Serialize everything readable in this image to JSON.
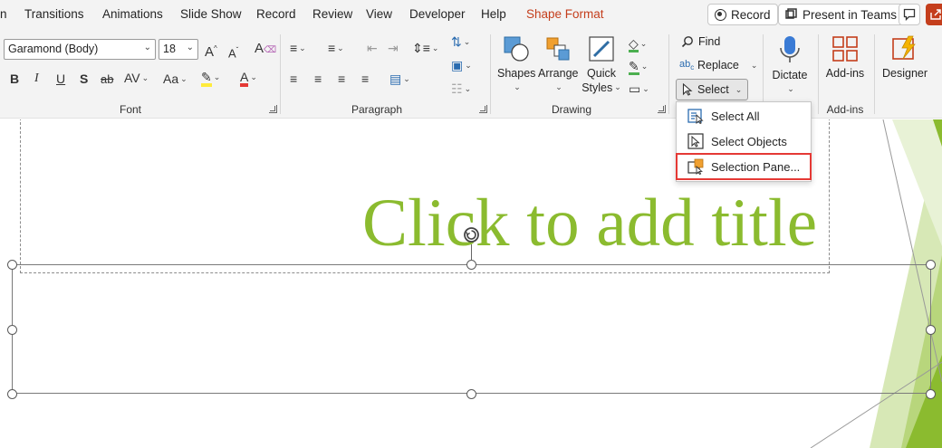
{
  "tabs": [
    "n",
    "Transitions",
    "Animations",
    "Slide Show",
    "Record",
    "Review",
    "View",
    "Developer",
    "Help",
    "Shape Format"
  ],
  "top_buttons": {
    "record": "Record",
    "present": "Present in Teams"
  },
  "font": {
    "name": "Garamond (Body)",
    "size": "18"
  },
  "groups": {
    "font": "Font",
    "paragraph": "Paragraph",
    "drawing": "Drawing",
    "add_ins": "Add-ins"
  },
  "drawing_buttons": {
    "shapes": "Shapes",
    "arrange": "Arrange",
    "quick_styles_1": "Quick",
    "quick_styles_2": "Styles"
  },
  "editing": {
    "find": "Find",
    "replace": "Replace",
    "select": "Select"
  },
  "voice": {
    "dictate": "Dictate"
  },
  "addins": {
    "addins": "Add-ins",
    "designer": "Designer"
  },
  "menu": {
    "items": [
      {
        "label": "Select All",
        "icon": "select-all-icon"
      },
      {
        "label": "Select Objects",
        "icon": "select-objects-icon"
      },
      {
        "label": "Selection Pane...",
        "icon": "selection-pane-icon"
      }
    ]
  },
  "slide": {
    "title_placeholder": "Click to add title"
  },
  "colors": {
    "accent": "#c43e1c",
    "title_green": "#8bbb2f",
    "highlight_red": "#e53935"
  }
}
